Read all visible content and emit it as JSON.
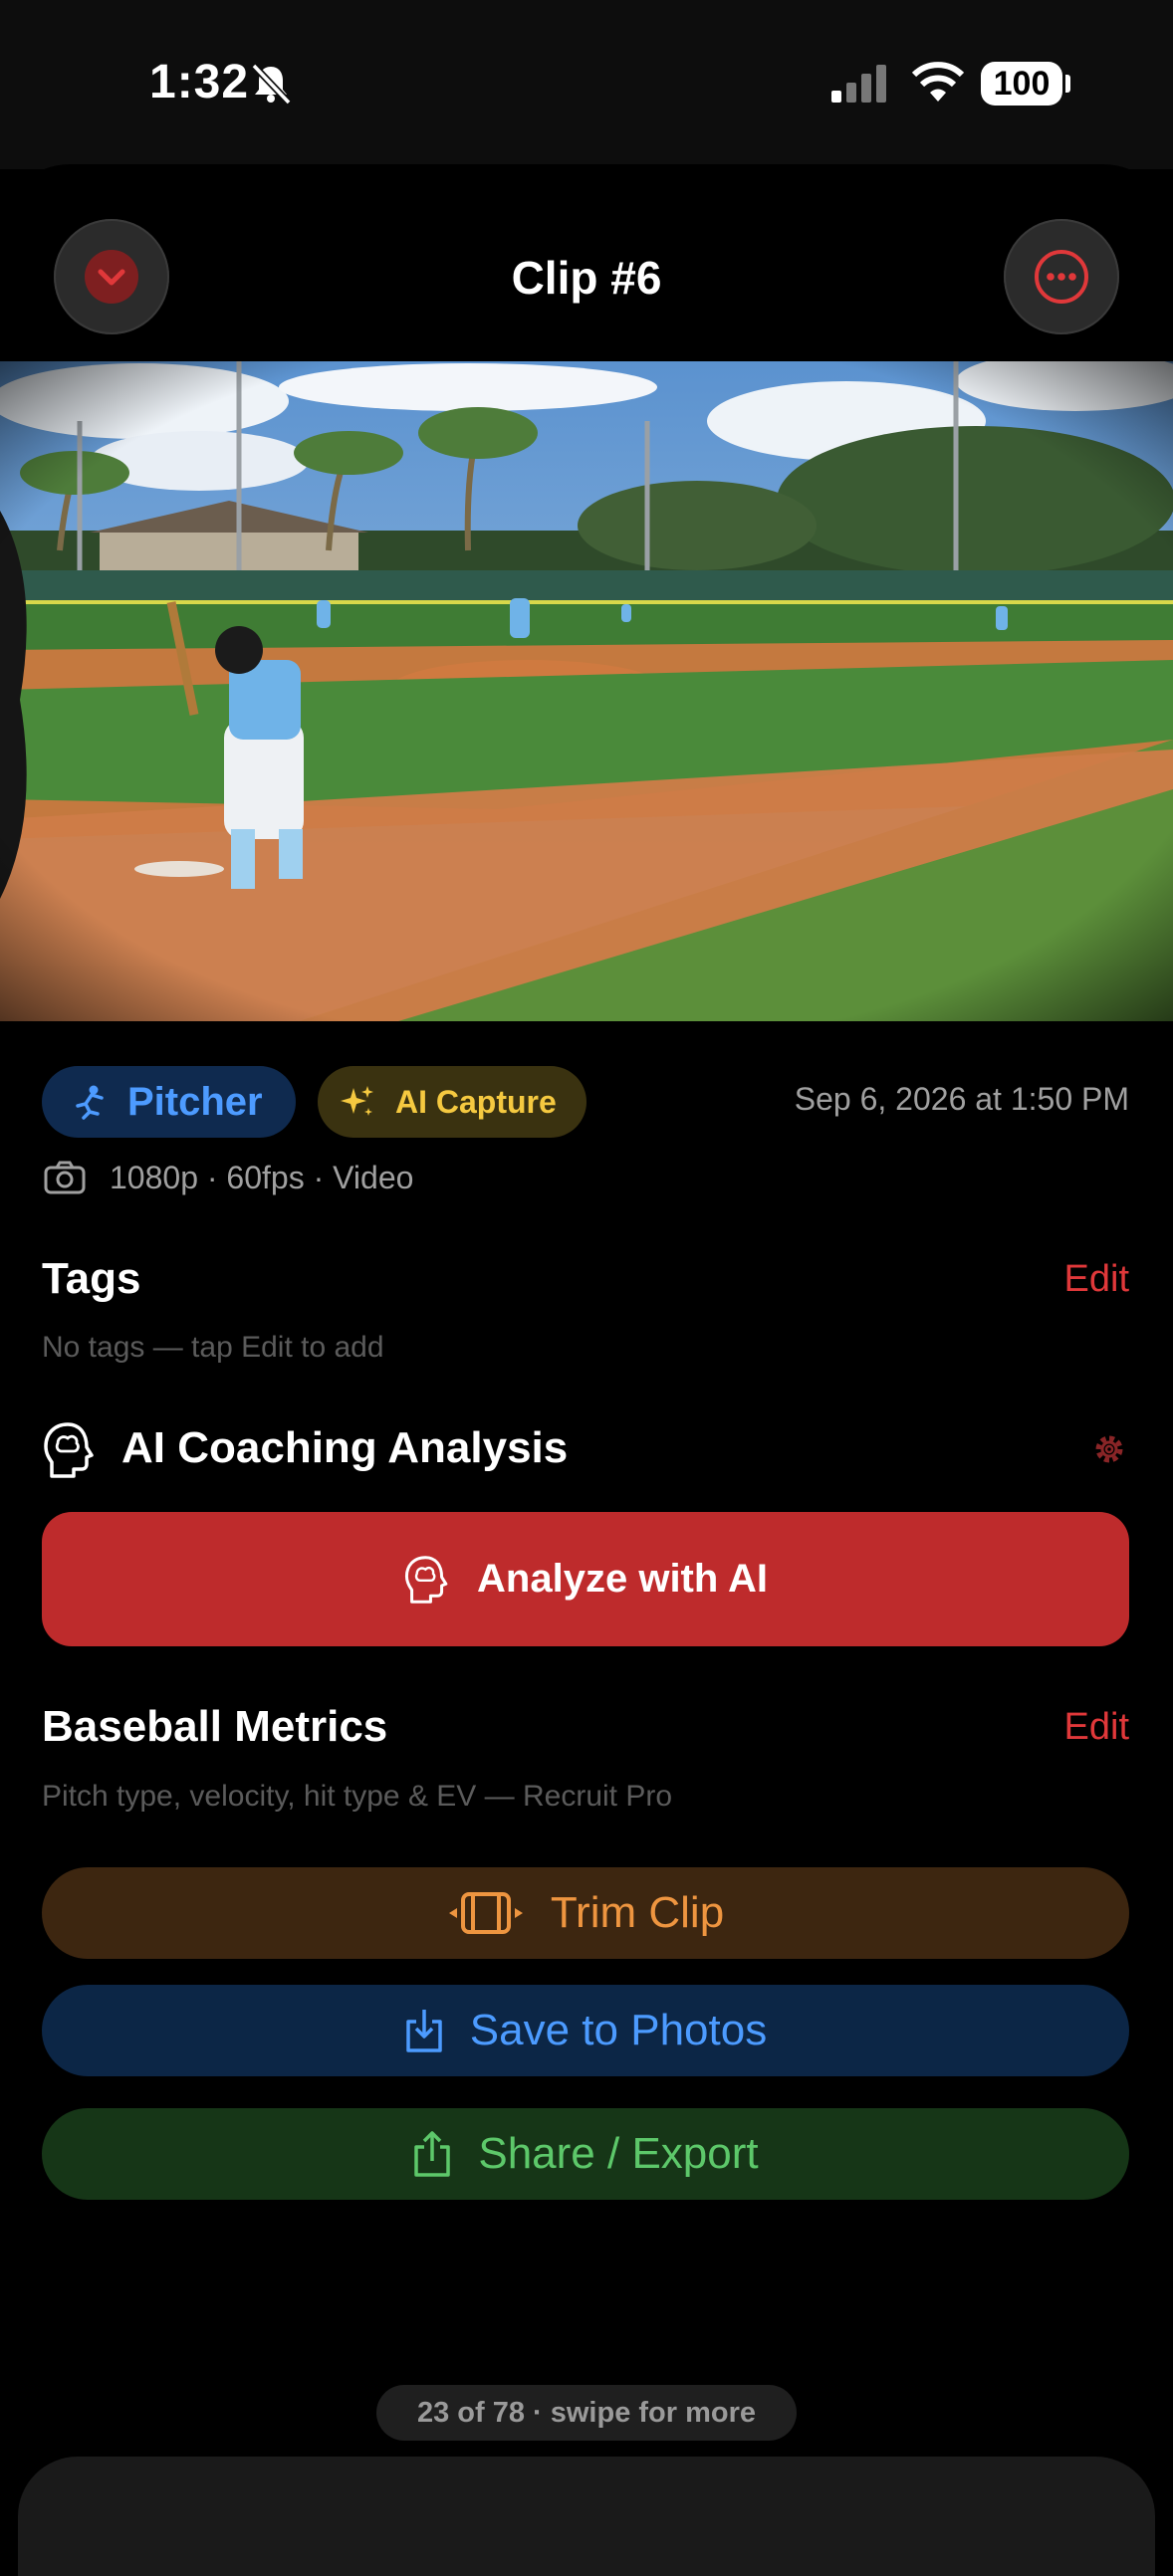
{
  "status_bar": {
    "time": "1:32",
    "battery": "100"
  },
  "nav": {
    "title": "Clip #6",
    "collapse_icon": "chevron-down-icon",
    "more_icon": "ellipsis-icon"
  },
  "clip": {
    "position_chip": "Pitcher",
    "capture_chip": "AI Capture",
    "date": "Sep 6, 2026 at 1:50 PM",
    "meta": "1080p · 60fps · Video"
  },
  "tags": {
    "title": "Tags",
    "edit": "Edit",
    "hint": "No tags — tap Edit to add"
  },
  "ai": {
    "title": "AI Coaching Analysis",
    "button": "Analyze with AI"
  },
  "metrics": {
    "title": "Baseball Metrics",
    "edit": "Edit",
    "hint": "Pitch type, velocity, hit type & EV — Recruit Pro"
  },
  "actions": {
    "trim": "Trim Clip",
    "save": "Save to Photos",
    "share": "Share / Export"
  },
  "pager": {
    "label": "23 of 78 · swipe for more"
  },
  "colors": {
    "accent_red": "#be2b2c",
    "blue": "#4c9bff",
    "orange": "#ee9540",
    "green": "#5dc86a",
    "gold": "#f5c940"
  }
}
